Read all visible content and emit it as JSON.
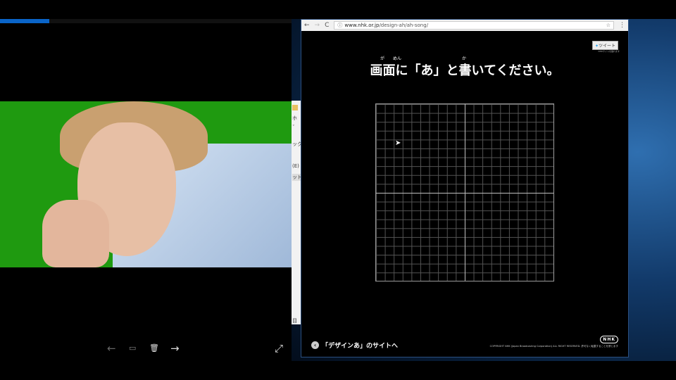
{
  "viewer": {
    "progress_percent": 17,
    "controls": {
      "prev": "←",
      "comment": "▭",
      "delete": "🗑",
      "next": "→",
      "expand": "⤢"
    }
  },
  "side_window": {
    "fragments": [
      "ホ",
      "ˇ",
      "ック",
      "(E)",
      "ットワ",
      "目"
    ]
  },
  "browser": {
    "nav": {
      "back": "←",
      "forward": "→",
      "reload": "C"
    },
    "url_info": "ⓘ",
    "url_host": "www.nhk.or.jp",
    "url_path": "/design-ah/ah-song/",
    "star": "☆",
    "menu": "⋮"
  },
  "page": {
    "tweet_label": "ツイート",
    "tweet_note": "NHKサイトを離れます",
    "ruby": [
      "が",
      "めん",
      "か"
    ],
    "title": "画面に「あ」と書いてください。",
    "back_link": "「デザインあ」のサイトへ",
    "logo": "NHK",
    "copyright": "COPYRIGHT NHK (Japan Broadcasting Corporation) ALL RIGHT RESERVED. 許可なく転載することを禁じます"
  }
}
